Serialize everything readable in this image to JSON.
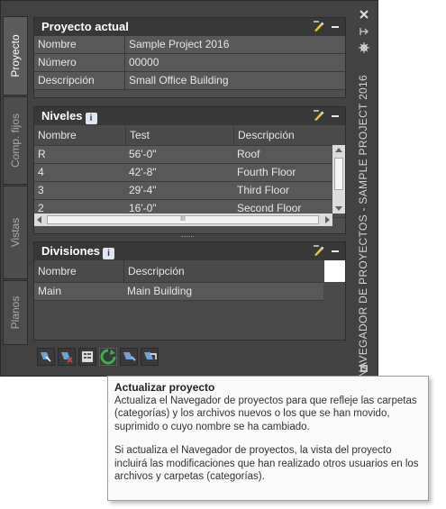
{
  "tabs": [
    "Proyecto",
    "Comp. fijos",
    "Vistas",
    "Planos"
  ],
  "window_title": "NAVEGADOR DE PROYECTOS - SAMPLE PROJECT 2016",
  "proyecto_actual": {
    "title": "Proyecto actual",
    "fields": [
      {
        "label": "Nombre",
        "value": "Sample Project 2016"
      },
      {
        "label": "Número",
        "value": "00000"
      },
      {
        "label": "Descripción",
        "value": "Small Office Building"
      }
    ]
  },
  "niveles": {
    "title": "Niveles",
    "headers": [
      "Nombre",
      "Test",
      "Descripción"
    ],
    "rows": [
      [
        "R",
        "56'-0\"",
        "Roof"
      ],
      [
        "4",
        "42'-8\"",
        "Fourth Floor"
      ],
      [
        "3",
        "29'-4\"",
        "Third Floor"
      ],
      [
        "2",
        "16'-0\"",
        "Second Floor"
      ]
    ],
    "scroll_mark": "III"
  },
  "divisiones": {
    "title": "Divisiones",
    "headers": [
      "Nombre",
      "Descripción"
    ],
    "rows": [
      [
        "Main",
        "Main Building"
      ]
    ]
  },
  "info_glyph": "i",
  "tooltip": {
    "title": "Actualizar proyecto",
    "p1": "Actualiza el Navegador de proyectos para que refleje las carpetas (categorías) y los archivos nuevos o los que se han movido, suprimido o cuyo nombre se ha cambiado.",
    "p2": "Si actualiza el Navegador de proyectos, la vista del proyecto incluirá las modificaciones que han realizado otros usuarios en los archivos y carpetas (categorías)."
  },
  "icons": [
    "close-icon",
    "autohide-icon",
    "properties-icon",
    "edit-icon",
    "minimize-icon",
    "info-icon",
    "refresh-icon"
  ]
}
